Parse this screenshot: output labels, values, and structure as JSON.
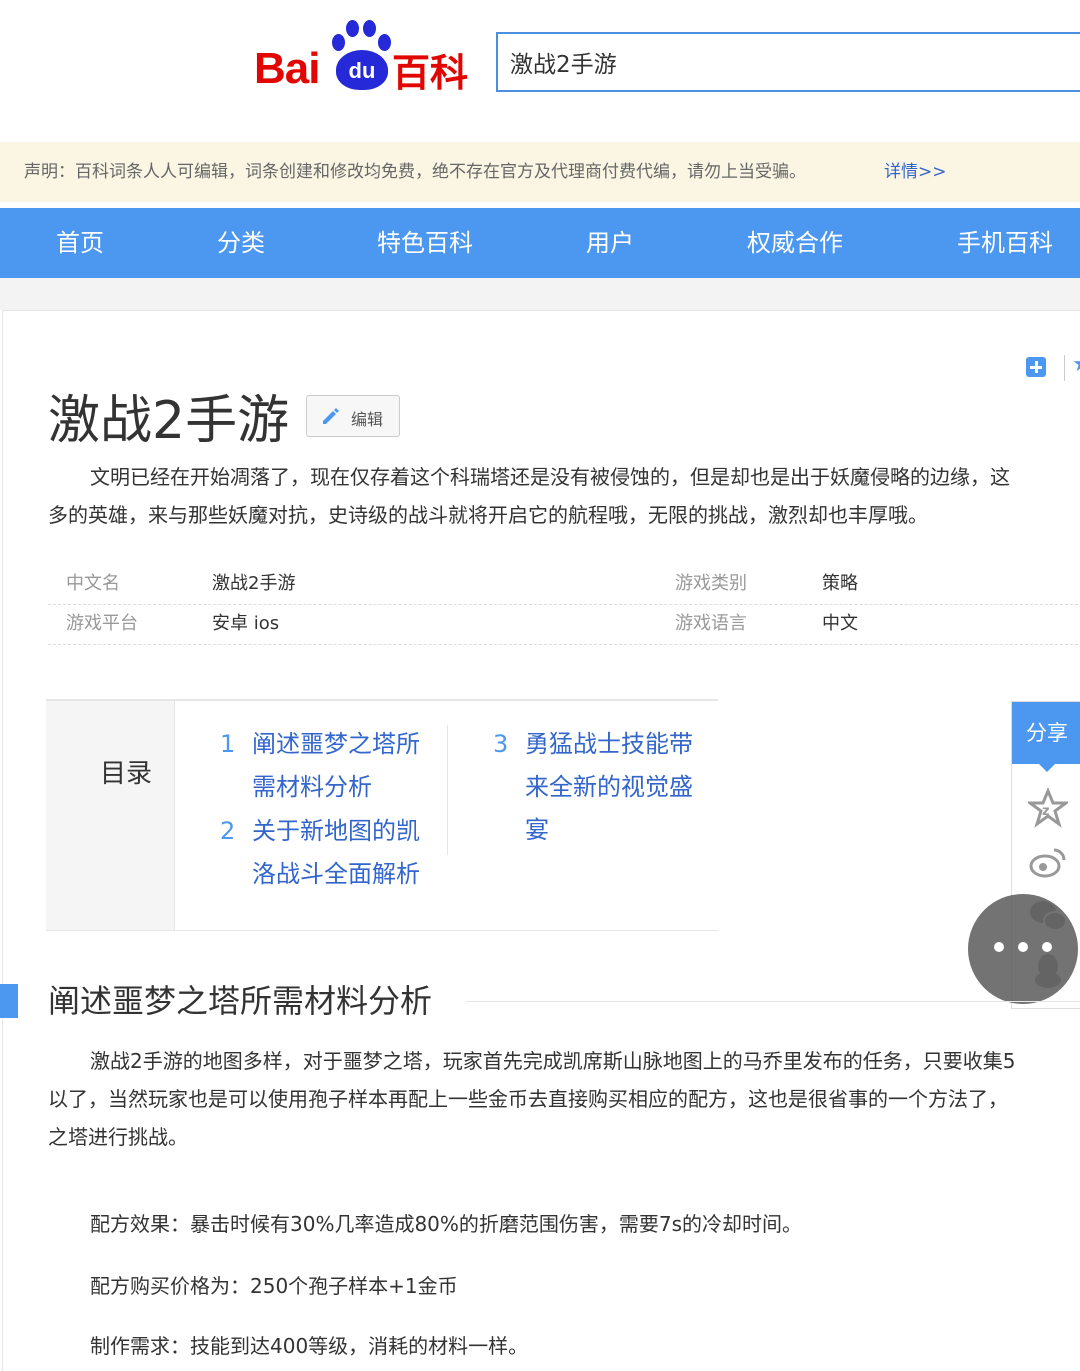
{
  "logo": {
    "bai": "Bai",
    "du": "du",
    "baike": "百科"
  },
  "search": {
    "value": "激战2手游"
  },
  "notice": {
    "text": "声明：百科词条人人可编辑，词条创建和修改均免费，绝不存在官方及代理商付费代编，请勿上当受骗。",
    "link": "详情>>"
  },
  "nav": {
    "items": [
      "首页",
      "分类",
      "特色百科",
      "用户",
      "权威合作",
      "手机百科"
    ]
  },
  "page": {
    "title": "激战2手游",
    "edit_label": "编辑"
  },
  "summary": {
    "line1": "文明已经在开始凋落了，现在仅存着这个科瑞塔还是没有被侵蚀的，但是却也是出于妖魔侵略的边缘，这",
    "line2": "多的英雄，来与那些妖魔对抗，史诗级的战斗就将开启它的航程哦，无限的挑战，激烈却也丰厚哦。"
  },
  "infobox": [
    {
      "k1": "中文名",
      "v1": "激战2手游",
      "k2": "游戏类别",
      "v2": "策略"
    },
    {
      "k1": "游戏平台",
      "v1": "安卓 ios",
      "k2": "游戏语言",
      "v2": "中文"
    }
  ],
  "catalog": {
    "head": "目录",
    "items": [
      {
        "num": "1",
        "line1": "阐述噩梦之塔所",
        "line2": "需材料分析"
      },
      {
        "num": "2",
        "line1": "关于新地图的凯",
        "line2": "洛战斗全面解析"
      },
      {
        "num": "3",
        "line1": "勇猛战士技能带",
        "line2": "来全新的视觉盛",
        "line3": "宴"
      }
    ]
  },
  "share": {
    "label": "分享"
  },
  "section": {
    "title": "阐述噩梦之塔所需材料分析",
    "para_line1": "激战2手游的地图多样，对于噩梦之塔，玩家首先完成凯席斯山脉地图上的马乔里发布的任务，只要收集5",
    "para_line2": "以了，当然玩家也是可以使用孢子样本再配上一些金币去直接购买相应的配方，这也是很省事的一个方法了，",
    "para_line3": "之塔进行挑战。",
    "effect": "配方效果：暴击时候有30%几率造成80%的折磨范围伤害，需要7s的冷却时间。",
    "price": "配方购买价格为：250个孢子样本+1金币",
    "require": "制作需求：技能到达400等级，消耗的材料一样。"
  },
  "colors": {
    "accent": "#4c97f0",
    "logo_red": "#e10601",
    "logo_blue": "#2529d8",
    "link": "#3366cc",
    "notice_bg": "#fbf6e4"
  }
}
